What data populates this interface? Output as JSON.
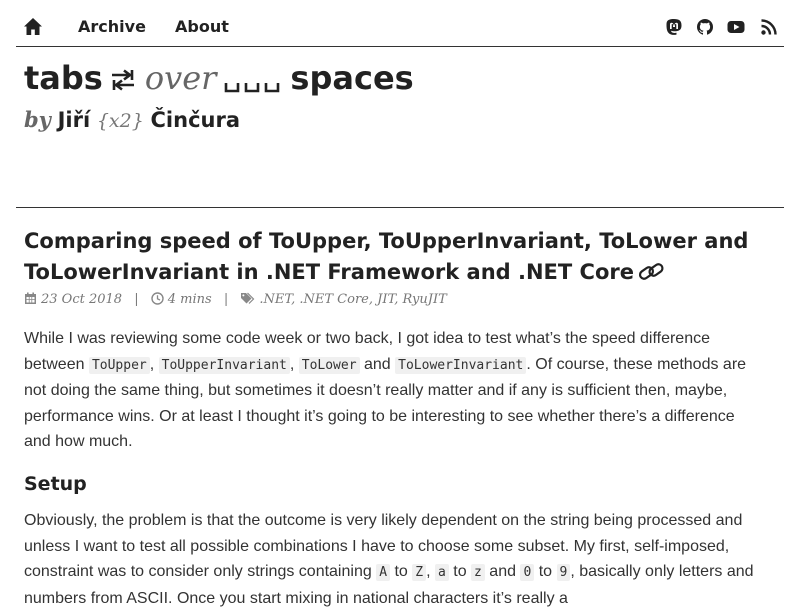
{
  "nav": {
    "archive": "Archive",
    "about": "About",
    "icons": [
      "home-icon",
      "mastodon-icon",
      "github-icon",
      "youtube-icon",
      "rss-icon"
    ]
  },
  "site": {
    "title_tabs": "tabs",
    "title_over": "over",
    "title_spaces": "spaces",
    "by": "by",
    "author_first": "Jiří",
    "author_nick": "{x2}",
    "author_last": "Činčura"
  },
  "post": {
    "title": "Comparing speed of ToUpper, ToUpperInvariant, ToLower and ToLowerInvariant in .NET Framework and .NET Core",
    "date": "23 Oct 2018",
    "reading_time": "4 mins",
    "tags": ".NET, .NET Core, JIT, RyuJIT",
    "p1": {
      "t1": "While I was reviewing some code week or two back, I got idea to test what’s the speed difference between ",
      "c1": "ToUpper",
      "t2": ", ",
      "c2": "ToUpperInvariant",
      "t3": ", ",
      "c3": "ToLower",
      "t4": " and ",
      "c4": "ToLowerInvariant",
      "t5": ". Of course, these methods are not doing the same thing, but sometimes it doesn’t really matter and if any is sufficient then, maybe, performance wins. Or at least I thought it’s going to be interesting to see whether there’s a difference and how much."
    },
    "setup_heading": "Setup",
    "p2": {
      "t1": "Obviously, the problem is that the outcome is very likely dependent on the string being processed and unless I want to test all possible combinations I have to choose some subset. My first, self-imposed, constraint was to consider only strings containing ",
      "c1": "A",
      "t2": " to ",
      "c2": "Z",
      "t3": ", ",
      "c3": "a",
      "t4": " to ",
      "c4": "z",
      "t5": " and ",
      "c5": "0",
      "t6": " to ",
      "c6": "9",
      "t7": ", basically only letters and numbers from ASCII. Once you start mixing in national characters it’s really a"
    }
  }
}
